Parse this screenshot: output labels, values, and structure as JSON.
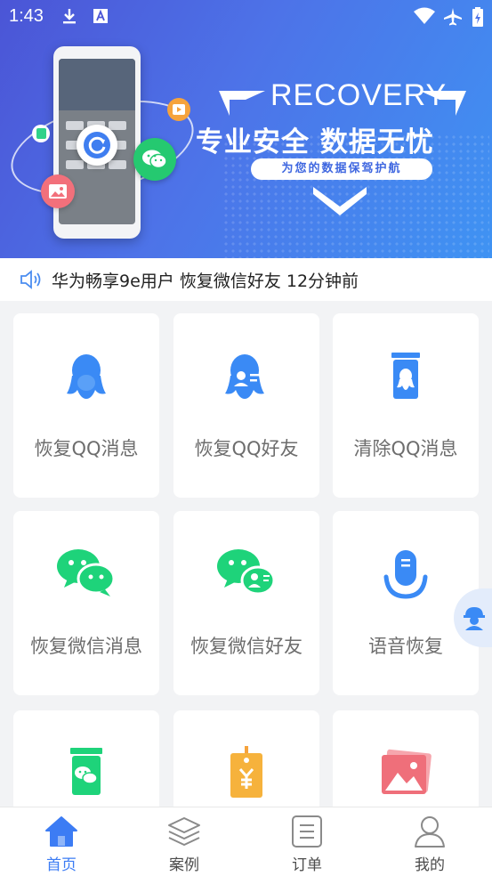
{
  "status_bar": {
    "time": "1:43"
  },
  "banner": {
    "title": "RECOVERY",
    "slogan": "专业安全  数据无忧",
    "subtitle": "为您的数据保驾护航"
  },
  "notice": {
    "text": "华为畅享9e用户 恢复微信好友 12分钟前"
  },
  "features": [
    {
      "label": "恢复QQ消息",
      "icon": "qq-penguin-icon"
    },
    {
      "label": "恢复QQ好友",
      "icon": "qq-contact-icon"
    },
    {
      "label": "清除QQ消息",
      "icon": "qq-trash-icon"
    },
    {
      "label": "恢复微信消息",
      "icon": "wechat-icon"
    },
    {
      "label": "恢复微信好友",
      "icon": "wechat-contact-icon"
    },
    {
      "label": "语音恢复",
      "icon": "microphone-icon"
    },
    {
      "label": "",
      "icon": "wechat-trash-icon"
    },
    {
      "label": "",
      "icon": "price-tag-icon"
    },
    {
      "label": "",
      "icon": "photo-icon"
    }
  ],
  "tabs": [
    {
      "label": "首页",
      "icon": "home-icon",
      "active": true
    },
    {
      "label": "案例",
      "icon": "layers-icon",
      "active": false
    },
    {
      "label": "订单",
      "icon": "order-icon",
      "active": false
    },
    {
      "label": "我的",
      "icon": "user-icon",
      "active": false
    }
  ],
  "colors": {
    "accent": "#3c7cf4",
    "qq_blue": "#3a8af5",
    "wechat_green": "#1ed37a",
    "banner_start": "#4b55d6",
    "banner_end": "#3f93f3"
  }
}
